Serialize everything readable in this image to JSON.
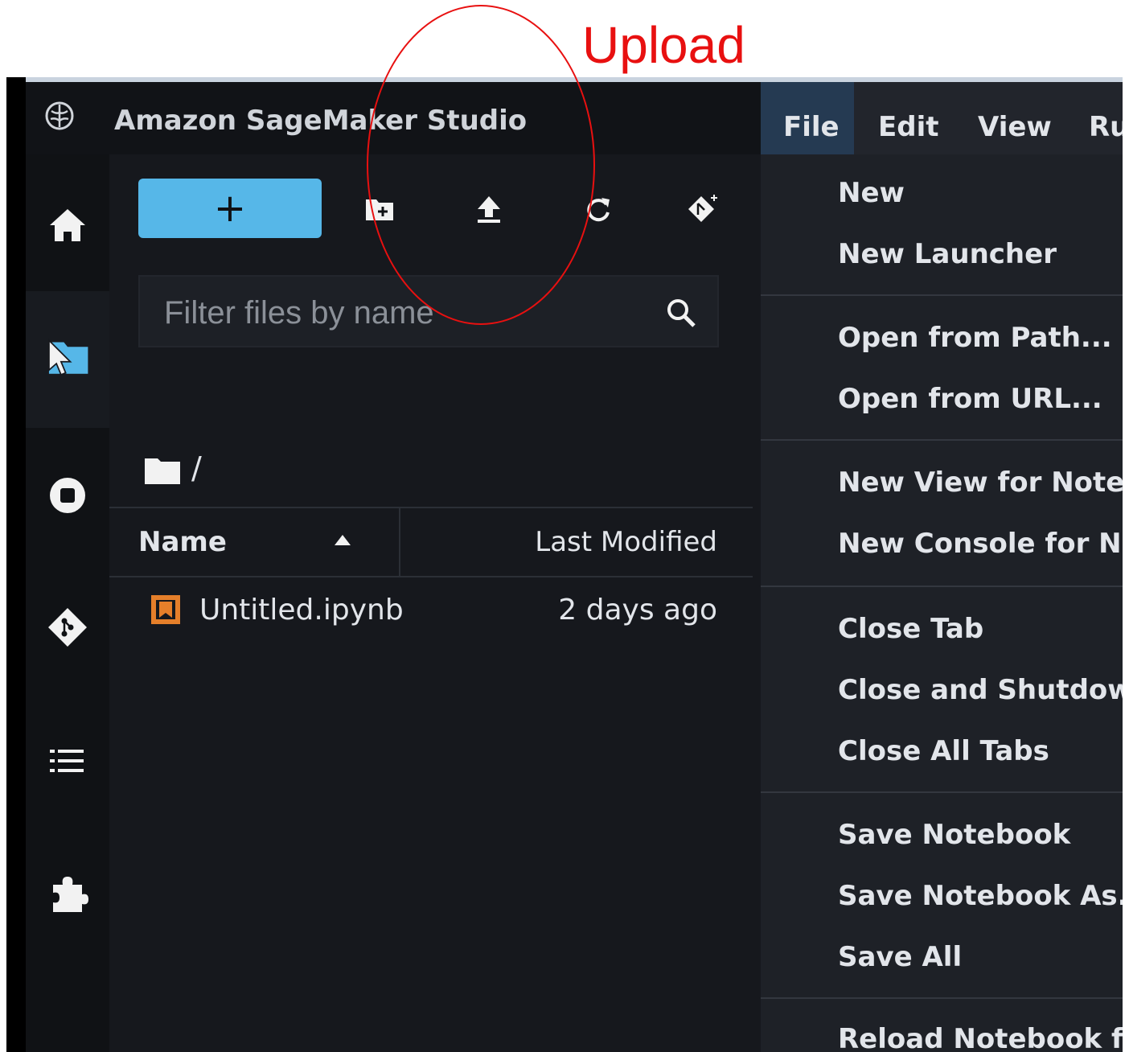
{
  "annotation": {
    "label": "Upload",
    "color": "#e81010"
  },
  "app": {
    "title": "Amazon SageMaker Studio"
  },
  "menubar": {
    "items": [
      "File",
      "Edit",
      "View",
      "Ru"
    ],
    "active": "File"
  },
  "activity_bar": {
    "icons": [
      "home-icon",
      "folder-icon",
      "cursor-icon",
      "stop-circle-icon",
      "git-icon",
      "list-icon",
      "puzzle-icon"
    ]
  },
  "file_browser": {
    "new_button_label": "+",
    "toolbar_icons": [
      "new-folder-icon",
      "upload-icon",
      "refresh-icon",
      "git-clone-icon"
    ],
    "search": {
      "placeholder": "Filter files by name",
      "value": ""
    },
    "breadcrumb": "/",
    "columns": {
      "name": "Name",
      "modified": "Last Modified"
    },
    "files": [
      {
        "name": "Untitled.ipynb",
        "modified": "2 days ago",
        "icon": "notebook-icon"
      }
    ]
  },
  "file_menu": {
    "items": [
      "New",
      "New Launcher",
      "Open from Path...",
      "Open from URL...",
      "New View for Notebo",
      "New Console for Not",
      "Close Tab",
      "Close and Shutdown",
      "Close All Tabs",
      "Save Notebook",
      "Save Notebook As...",
      "Save All",
      "Reload Notebook fro"
    ]
  },
  "colors": {
    "accent": "#56b7e8",
    "background": "#16181d",
    "menu_bg": "#1e2127",
    "active_menu": "#253a52",
    "notebook_icon": "#e57f2a"
  }
}
